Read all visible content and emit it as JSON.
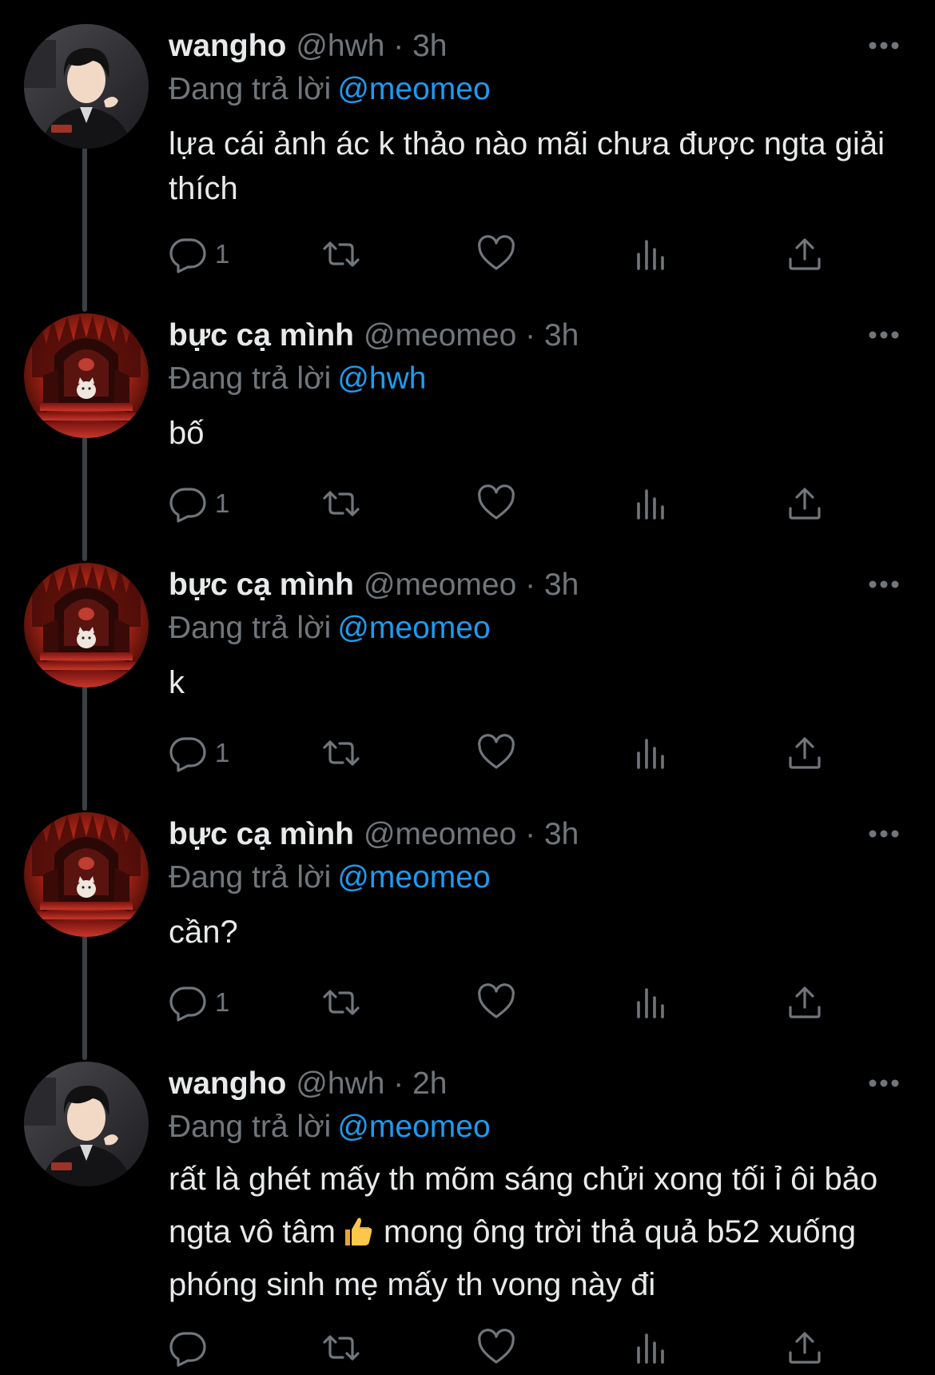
{
  "colors": {
    "background": "#000000",
    "primary_text": "#e7e9ea",
    "secondary_text": "#71767b",
    "accent": "#1d9bf0",
    "thread_line": "#3a3f44"
  },
  "tweets": [
    {
      "avatar": "wangho-avatar",
      "name": "wangho",
      "handle": "@hwh",
      "time": "3h",
      "meta": "@hwh · 3h",
      "replying_label": "Đang trả lời",
      "replying_to": "@meomeo",
      "text": "lựa cái ảnh ác k thảo nào mãi chưa được ngta giải thích",
      "reply_count": "1"
    },
    {
      "avatar": "throne-avatar",
      "name": "bực cạ mình",
      "handle": "@meomeo",
      "time": "3h",
      "meta": "@meomeo · 3h",
      "replying_label": "Đang trả lời",
      "replying_to": "@hwh",
      "text": "bố",
      "reply_count": "1"
    },
    {
      "avatar": "throne-avatar",
      "name": "bực cạ mình",
      "handle": "@meomeo",
      "time": "3h",
      "meta": "@meomeo · 3h",
      "replying_label": "Đang trả lời",
      "replying_to": "@meomeo",
      "text": "k",
      "reply_count": "1"
    },
    {
      "avatar": "throne-avatar",
      "name": "bực cạ mình",
      "handle": "@meomeo",
      "time": "3h",
      "meta": "@meomeo · 3h",
      "replying_label": "Đang trả lời",
      "replying_to": "@meomeo",
      "text": "cần?",
      "reply_count": "1"
    },
    {
      "avatar": "wangho-avatar",
      "name": "wangho",
      "handle": "@hwh",
      "time": "2h",
      "meta": "@hwh · 2h",
      "replying_label": "Đang trả lời",
      "replying_to": "@meomeo",
      "text_part1": "rất là ghét mấy th mõm sáng chửi xong tối ỉ ôi bảo ngta vô tâm",
      "emoji": "thumbs-up-emoji",
      "text_part2": "mong ông trời thả quả b52 xuống phóng sinh mẹ mấy th vong này đi",
      "reply_count": ""
    }
  ],
  "icons": {
    "reply": "speech-bubble-icon",
    "retweet": "retweet-arrows-icon",
    "like": "heart-icon",
    "views": "bar-chart-icon",
    "share": "share-upload-icon",
    "more": "more-dots-icon"
  }
}
